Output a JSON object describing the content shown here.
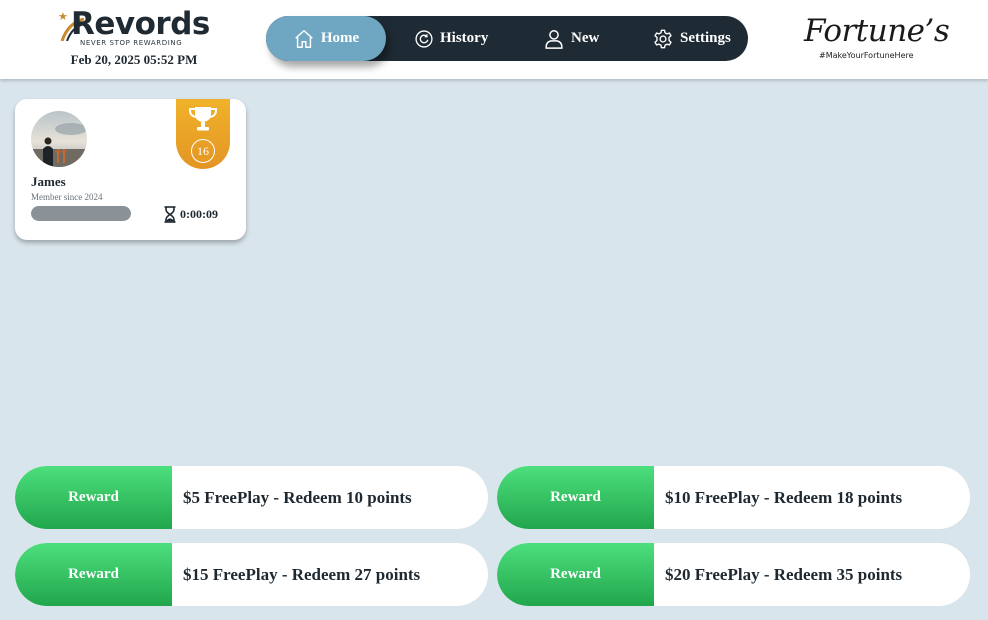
{
  "header": {
    "logo": {
      "word": "Revords",
      "tagline": "NEVER STOP REWARDING"
    },
    "datetime": "Feb 20, 2025 05:52 PM",
    "nav": [
      {
        "label": "Home",
        "icon": "home-icon",
        "active": true
      },
      {
        "label": "History",
        "icon": "history-icon",
        "active": false
      },
      {
        "label": "New",
        "icon": "user-icon",
        "active": false
      },
      {
        "label": "Settings",
        "icon": "gear-icon",
        "active": false
      }
    ],
    "business_logo": {
      "word": "Fortune’s",
      "tagline": "#MakeYourFortuneHere"
    }
  },
  "player_card": {
    "name": "James",
    "member_since": "Member since 2024",
    "level": "16",
    "timer": "0:00:09",
    "progress_fraction": 1.0,
    "badge_icon": "trophy-icon",
    "timer_icon": "hourglass-icon"
  },
  "rewards": [
    {
      "button": "Reward",
      "description": "$5 FreePlay - Redeem 10 points"
    },
    {
      "button": "Reward",
      "description": "$10 FreePlay - Redeem 18 points"
    },
    {
      "button": "Reward",
      "description": "$15 FreePlay - Redeem 27 points"
    },
    {
      "button": "Reward",
      "description": "$20 FreePlay - Redeem 35 points"
    }
  ],
  "colors": {
    "background": "#d9e5ec",
    "nav_bg": "#1f2b34",
    "nav_active": "#6fa6c2",
    "badge_gold": "#e9a326",
    "reward_green": "#2fbf5c"
  }
}
